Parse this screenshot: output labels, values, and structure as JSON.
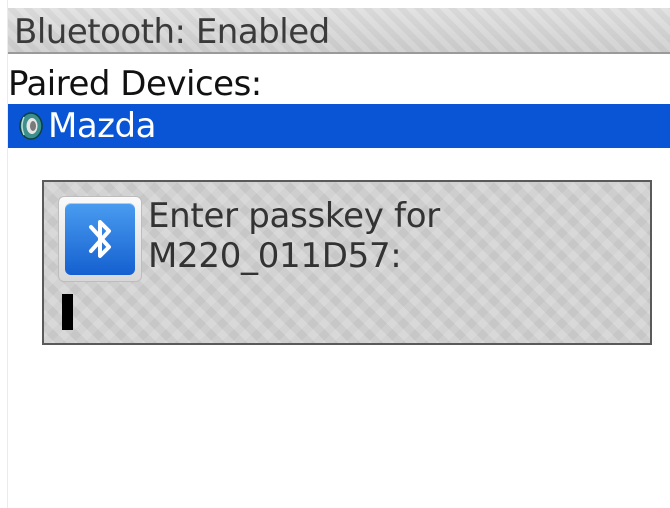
{
  "header": {
    "title": "Bluetooth: Enabled"
  },
  "paired_devices": {
    "label": "Paired Devices:",
    "items": [
      {
        "name": "Mazda",
        "selected": true,
        "icon": "device-sound-icon"
      }
    ]
  },
  "dialog": {
    "icon": "bluetooth-icon",
    "prompt": "Enter passkey for\nM220_011D57:",
    "passkey_value": ""
  },
  "colors": {
    "selection": "#0a55d6",
    "bluetooth_blue": "#1e73e0"
  }
}
